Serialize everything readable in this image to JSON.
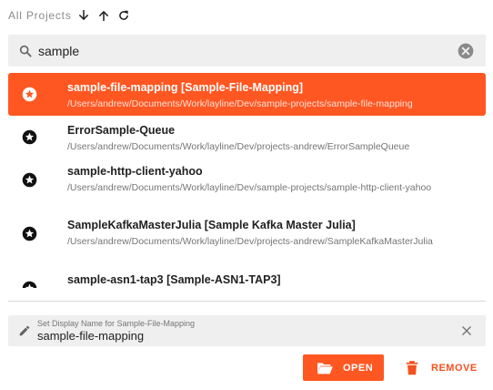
{
  "header": {
    "title": "All Projects",
    "icons": [
      "arrow-down-icon",
      "arrow-up-icon",
      "refresh-icon"
    ]
  },
  "search": {
    "value": "sample",
    "icon": "search-icon",
    "clear_icon": "clear-circle-icon"
  },
  "projects": [
    {
      "name": "sample-file-mapping [Sample-File-Mapping]",
      "path": "/Users/andrew/Documents/Work/layline/Dev/sample-projects/sample-file-mapping",
      "selected": true
    },
    {
      "name": "ErrorSample-Queue",
      "path": "/Users/andrew/Documents/Work/layline/Dev/projects-andrew/ErrorSampleQueue",
      "selected": false
    },
    {
      "name": "sample-http-client-yahoo",
      "path": "/Users/andrew/Documents/Work/layline/Dev/sample-projects/sample-http-client-yahoo",
      "selected": false
    },
    {
      "name": "SampleKafkaMasterJulia [Sample Kafka Master Julia]",
      "path": "/Users/andrew/Documents/Work/layline/Dev/projects-andrew/SampleKafkaMasterJulia",
      "selected": false
    },
    {
      "name": "sample-asn1-tap3 [Sample-ASN1-TAP3]",
      "path": "",
      "selected": false
    }
  ],
  "rename": {
    "label": "Set Display Name for Sample-File-Mapping",
    "value": "sample-file-mapping"
  },
  "actions": {
    "open_label": "OPEN",
    "remove_label": "REMOVE"
  },
  "colors": {
    "accent": "#ff5722",
    "remove": "#f4511e"
  }
}
